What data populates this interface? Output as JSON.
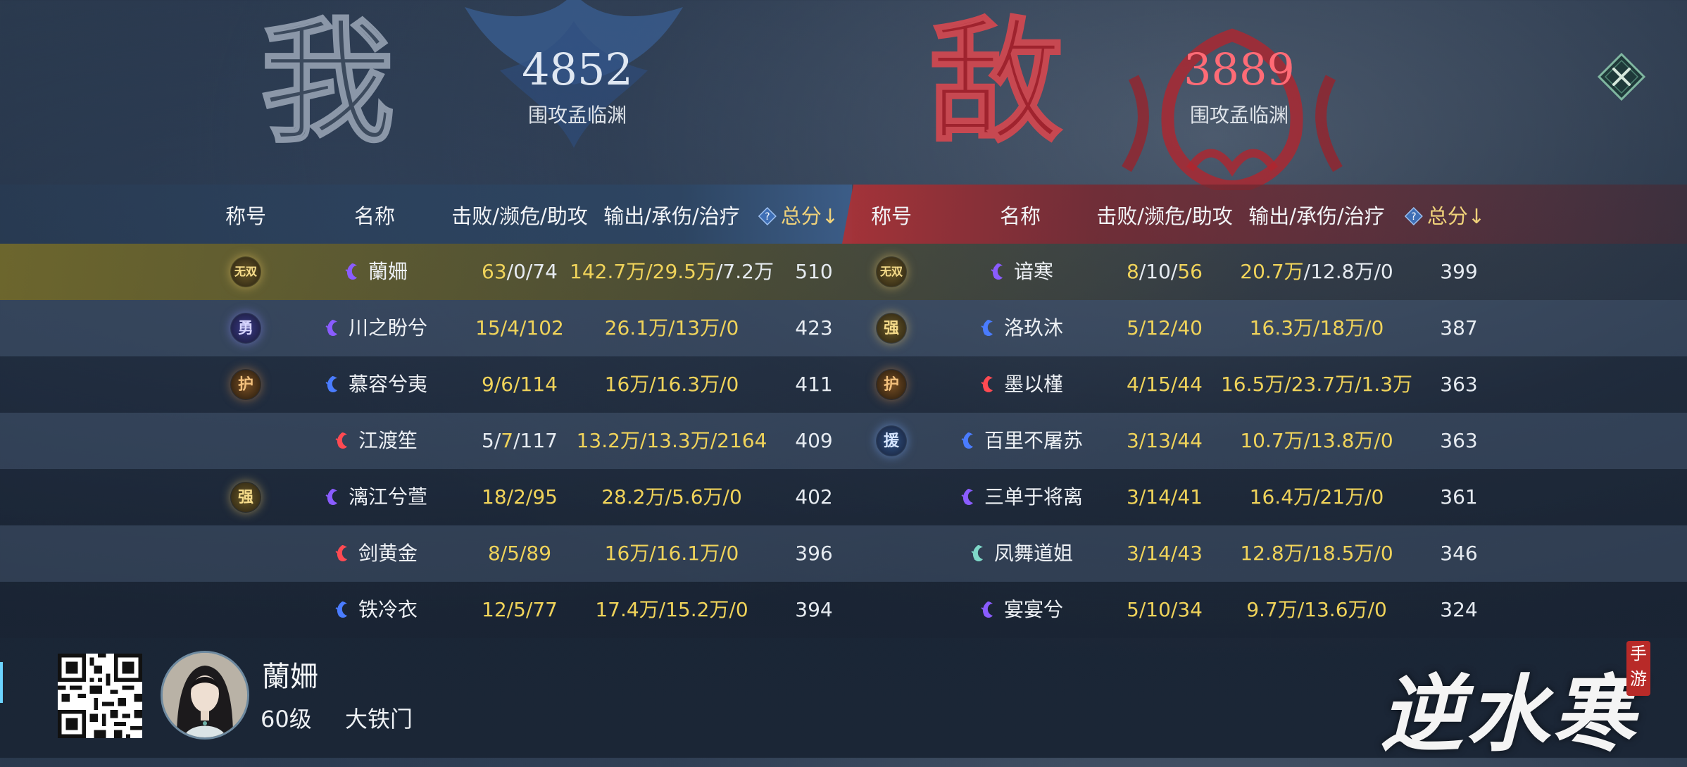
{
  "ally": {
    "glyph": "我",
    "score": "4852",
    "subtitle": "围攻孟临渊"
  },
  "enemy": {
    "glyph": "敌",
    "score": "3889",
    "subtitle": "围攻孟临渊"
  },
  "headers": {
    "title": "称号",
    "name": "名称",
    "kda": "击败/濒危/助攻",
    "stats": "输出/承伤/治疗",
    "help": "?",
    "total": "总分↓"
  },
  "ally_rows": [
    {
      "badge": "无双",
      "badge_style": "gold",
      "school": "violet",
      "name": "蘭姍",
      "kda": [
        "63",
        "/0/74"
      ],
      "stats": [
        "142.7万/29.5万",
        "/7.2万"
      ],
      "total": "510"
    },
    {
      "badge": "勇",
      "badge_style": "violet",
      "school": "violet",
      "name": "川之盼兮",
      "kda": [
        "",
        "15/4/102"
      ],
      "stats": [
        "",
        "26.1万/13万/0"
      ],
      "total": "423"
    },
    {
      "badge": "护",
      "badge_style": "amber",
      "school": "blue",
      "name": "慕容兮夷",
      "kda": [
        "",
        "9/6/114"
      ],
      "stats": [
        "",
        "16万/16.3万/0"
      ],
      "total": "411"
    },
    {
      "badge": "",
      "badge_style": "",
      "school": "red",
      "name": "江渡笙",
      "kda": [
        "5/",
        "7",
        "/117"
      ],
      "stats": [
        "",
        "13.2万/13.3万/2164"
      ],
      "total": "409"
    },
    {
      "badge": "强",
      "badge_style": "gold",
      "school": "violet",
      "name": "漓江兮萱",
      "kda": [
        "",
        "18/2/95"
      ],
      "stats": [
        "",
        "28.2万/5.6万/0"
      ],
      "total": "402"
    },
    {
      "badge": "",
      "badge_style": "",
      "school": "red",
      "name": "剑黄金",
      "kda": [
        "",
        "8/5/89"
      ],
      "stats": [
        "",
        "16万/16.1万/0"
      ],
      "total": "396"
    },
    {
      "badge": "",
      "badge_style": "",
      "school": "blue",
      "name": "铁冷衣",
      "kda": [
        "",
        "12/5/77"
      ],
      "stats": [
        "",
        "17.4万/15.2万/0"
      ],
      "total": "394"
    }
  ],
  "enemy_rows": [
    {
      "badge": "无双",
      "badge_style": "gold",
      "school": "violet",
      "name": "谙寒",
      "kda": [
        "8",
        "/10/",
        "56"
      ],
      "stats": [
        "20.7万",
        "/12.8万/0"
      ],
      "total": "399"
    },
    {
      "badge": "强",
      "badge_style": "gold",
      "school": "blue",
      "name": "洛玖沐",
      "kda": [
        "",
        "5/12/40"
      ],
      "stats": [
        "",
        "16.3万/18万/0"
      ],
      "total": "387"
    },
    {
      "badge": "护",
      "badge_style": "amber",
      "school": "red",
      "name": "墨以槿",
      "kda": [
        "",
        "4/15/44"
      ],
      "stats": [
        "",
        "16.5万/23.7万/1.3万"
      ],
      "total": "363"
    },
    {
      "badge": "援",
      "badge_style": "blue",
      "school": "blue",
      "name": "百里不屠苏",
      "kda": [
        "",
        "3/13/44"
      ],
      "stats": [
        "",
        "10.7万/13.8万/0"
      ],
      "total": "363"
    },
    {
      "badge": "",
      "badge_style": "",
      "school": "violet",
      "name": "三单于将离",
      "kda": [
        "",
        "3/14/41"
      ],
      "stats": [
        "",
        "16.4万/21万/0"
      ],
      "total": "361"
    },
    {
      "badge": "",
      "badge_style": "",
      "school": "teal",
      "name": "凤舞道姐",
      "kda": [
        "",
        "3/14/43"
      ],
      "stats": [
        "",
        "12.8万/18.5万/0"
      ],
      "total": "346"
    },
    {
      "badge": "",
      "badge_style": "",
      "school": "violet",
      "name": "宴宴兮",
      "kda": [
        "",
        "5/10/34"
      ],
      "stats": [
        "",
        "9.7万/13.6万/0"
      ],
      "total": "324"
    }
  ],
  "player": {
    "name": "蘭姍",
    "level": "60级",
    "guild": "大铁门"
  },
  "logo": {
    "title": "逆水寒",
    "seal": "手游"
  },
  "colors": {
    "ally_accent": "#dfe7f2",
    "enemy_accent": "#ff6b76",
    "highlight_gold": "#f0d35a"
  },
  "icons": {
    "close": "close-x-diamond-icon",
    "help": "question-diamond-icon",
    "qr": "qr-code-icon"
  }
}
